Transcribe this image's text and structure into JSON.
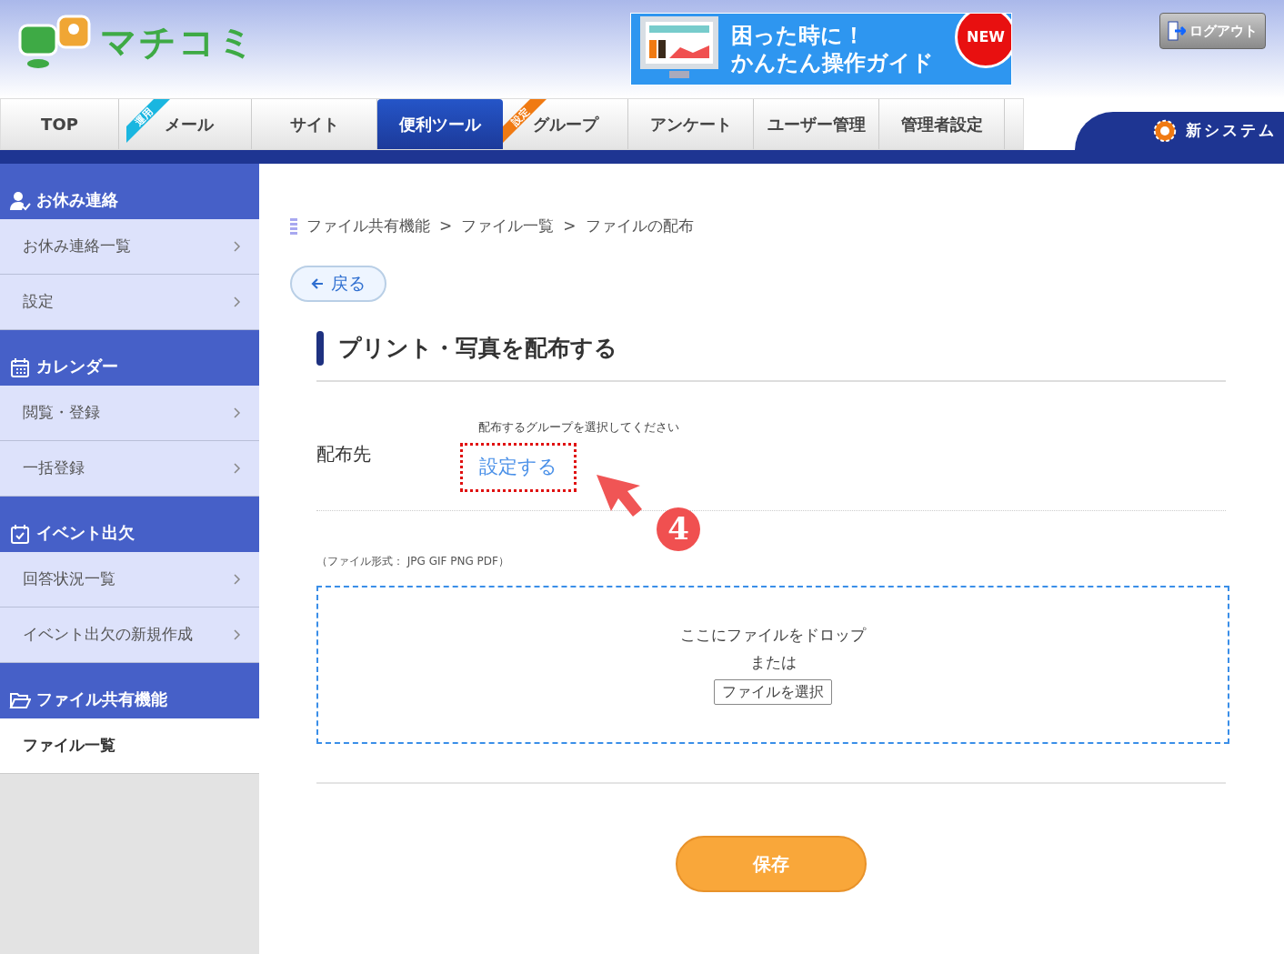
{
  "header": {
    "logo": "マチコミ",
    "banner": {
      "line1": "困った時に！",
      "line2": "かんたん操作ガイド",
      "badge": "NEW"
    },
    "logout": "ログアウト",
    "new_system": "新システム"
  },
  "tabs": [
    {
      "label": "TOP",
      "selected": false
    },
    {
      "label": "メール",
      "selected": false,
      "badge": {
        "text": "運用",
        "color": "#1ab6e0"
      }
    },
    {
      "label": "サイト",
      "selected": false
    },
    {
      "label": "便利ツール",
      "selected": true
    },
    {
      "label": "グループ",
      "selected": false,
      "badge": {
        "text": "設定",
        "color": "#f07a12"
      }
    },
    {
      "label": "アンケート",
      "selected": false
    },
    {
      "label": "ユーザー管理",
      "selected": false
    },
    {
      "label": "管理者設定",
      "selected": false
    }
  ],
  "sidebar": [
    {
      "title": "お休み連絡",
      "kind": "user",
      "items": [
        {
          "label": "お休み連絡一覧",
          "selected": false
        },
        {
          "label": "設定",
          "selected": false
        }
      ]
    },
    {
      "title": "カレンダー",
      "kind": "calendar",
      "items": [
        {
          "label": "閲覧・登録",
          "selected": false
        },
        {
          "label": "一括登録",
          "selected": false
        }
      ]
    },
    {
      "title": "イベント出欠",
      "kind": "check",
      "items": [
        {
          "label": "回答状況一覧",
          "selected": false
        },
        {
          "label": "イベント出欠の新規作成",
          "selected": false
        }
      ]
    },
    {
      "title": "ファイル共有機能",
      "kind": "folder",
      "items": [
        {
          "label": "ファイル一覧",
          "selected": true
        }
      ]
    }
  ],
  "breadcrumb": [
    "ファイル共有機能",
    "ファイル一覧",
    "ファイルの配布"
  ],
  "breadcrumb_separator": ">",
  "back_button": "戻る",
  "title": "プリント・写真を配布する",
  "recipient": {
    "label": "配布先",
    "hint": "配布するグループを選択してください",
    "link": "設定する"
  },
  "step_marker": "4",
  "formats_note": "（ファイル形式： JPG GIF PNG PDF）",
  "dropzone": {
    "line1": "ここにファイルをドロップ",
    "line2": "または",
    "button": "ファイルを選択"
  },
  "save_button": "保存"
}
